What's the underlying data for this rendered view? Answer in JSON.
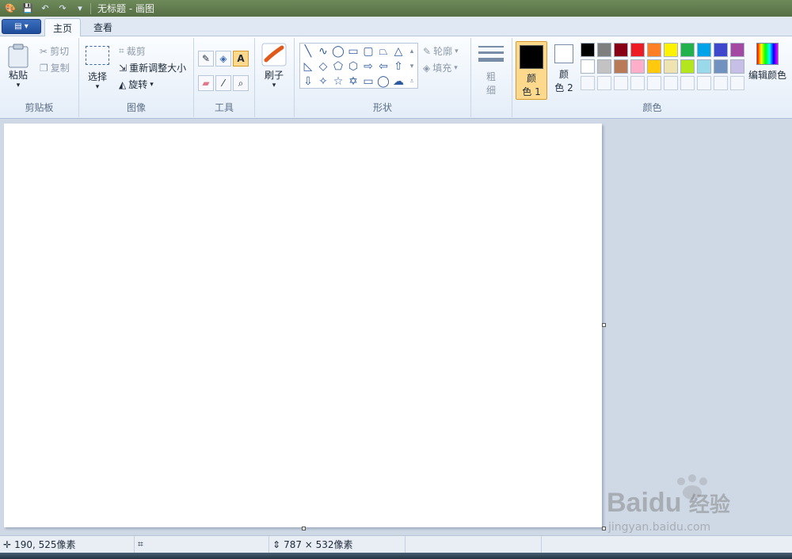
{
  "window": {
    "title": "无标题 - 画图"
  },
  "tabs": [
    {
      "label": "主页"
    },
    {
      "label": "查看"
    }
  ],
  "groups": {
    "clipboard": {
      "label": "剪贴板",
      "paste": "粘贴",
      "cut": "剪切",
      "copy": "复制"
    },
    "image": {
      "label": "图像",
      "select": "选择",
      "crop": "裁剪",
      "resize": "重新调整大小",
      "rotate": "旋转"
    },
    "tools": {
      "label": "工具",
      "text_tool": "A"
    },
    "brushes": {
      "label": "刷子"
    },
    "shapes": {
      "label": "形状",
      "outline": "轮廓",
      "fill": "填充"
    },
    "size": {
      "label_line1": "粗",
      "label_line2": "细"
    },
    "colors": {
      "label": "颜色",
      "color1_line1": "颜",
      "color1_line2": "色 1",
      "color2_line1": "颜",
      "color2_line2": "色 2",
      "edit": "编辑颜色",
      "color1": "#000000",
      "color2": "#ffffff",
      "palette_row1": [
        "#000000",
        "#7f7f7f",
        "#880015",
        "#ed1c24",
        "#ff7f27",
        "#fff200",
        "#22b14c",
        "#00a2e8",
        "#3f48cc",
        "#a349a4"
      ],
      "palette_row2": [
        "#ffffff",
        "#c3c3c3",
        "#b97a57",
        "#ffaec9",
        "#ffc90e",
        "#efe4b0",
        "#b5e61d",
        "#99d9ea",
        "#7092be",
        "#c8bfe7"
      ]
    }
  },
  "status": {
    "cursor_pos": "190, 525像素",
    "canvas_size": "787 × 532像素"
  },
  "watermark": {
    "brand": "Bai",
    "brand2": "du",
    "cn": "经验",
    "url": "jingyan.baidu.com"
  }
}
